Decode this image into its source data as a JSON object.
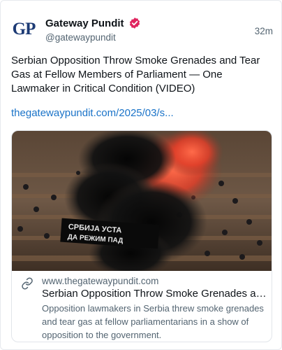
{
  "author": {
    "avatar_text_g": "G",
    "avatar_text_p": "P",
    "display_name": "Gateway Pundit",
    "handle": "@gatewaypundit",
    "verified_icon": "verified-badge-icon",
    "badge_color": "#e0245e"
  },
  "post": {
    "time": "32m",
    "text": "Serbian Opposition Throw Smoke Grenades and Tear Gas at Fellow Members of Parliament — One Lawmaker in Critical Condition (VIDEO)",
    "link": "thegatewaypundit.com/2025/03/s..."
  },
  "link_card": {
    "image_banner_line1": "СРБИЈА УСТА",
    "image_banner_line2": "ДА РЕЖИМ ПАД",
    "link_icon": "link-icon",
    "domain": "www.thegatewaypundit.com",
    "title": "Serbian Opposition Throw Smoke Grenades an...",
    "description": "Opposition lawmakers in Serbia threw smoke grenades and tear gas at fellow parliamentarians in a show of opposition to the government."
  },
  "colors": {
    "link": "#1a73c8",
    "secondary_text": "#536471",
    "logo_blue": "#1d3b75"
  }
}
